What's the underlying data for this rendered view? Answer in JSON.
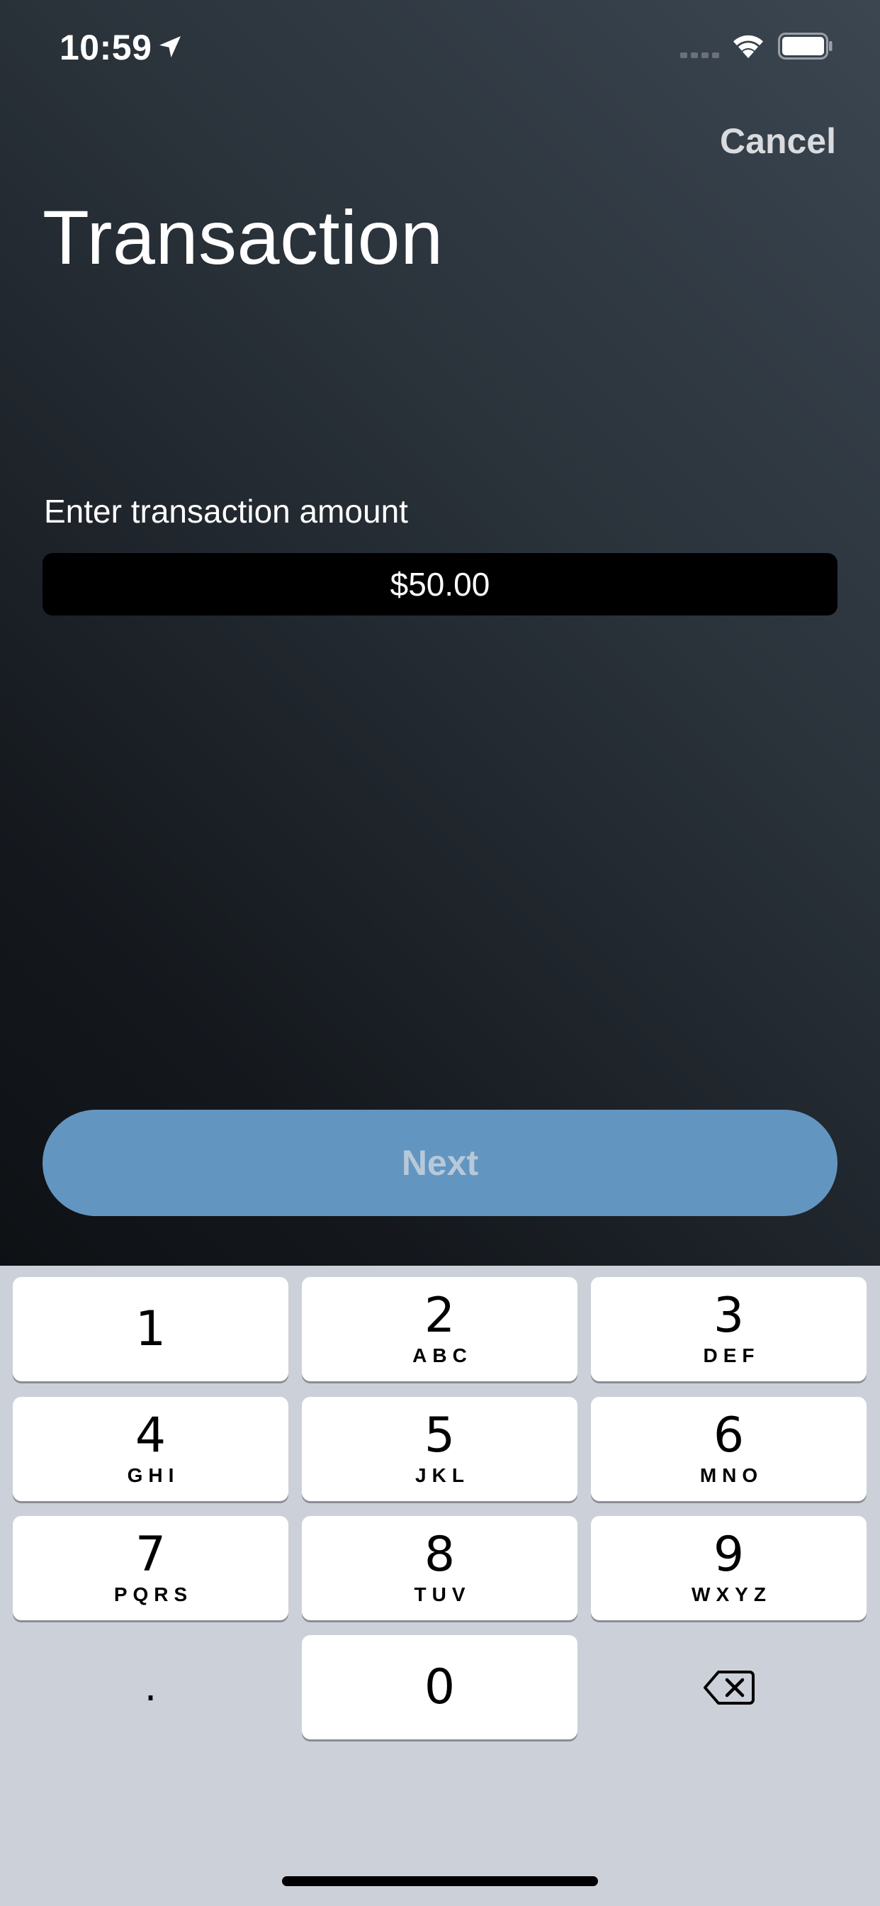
{
  "status_bar": {
    "time": "10:59",
    "icons": [
      "location-arrow-icon",
      "cellular-signal-icon",
      "wifi-icon",
      "battery-icon"
    ]
  },
  "header": {
    "cancel_label": "Cancel",
    "title": "Transaction"
  },
  "form": {
    "amount_label": "Enter transaction amount",
    "amount_value": "$50.00"
  },
  "next_label": "Next",
  "keypad": {
    "keys": [
      {
        "digit": "1",
        "letters": ""
      },
      {
        "digit": "2",
        "letters": "ABC"
      },
      {
        "digit": "3",
        "letters": "DEF"
      },
      {
        "digit": "4",
        "letters": "GHI"
      },
      {
        "digit": "5",
        "letters": "JKL"
      },
      {
        "digit": "6",
        "letters": "MNO"
      },
      {
        "digit": "7",
        "letters": "PQRS"
      },
      {
        "digit": "8",
        "letters": "TUV"
      },
      {
        "digit": "9",
        "letters": "WXYZ"
      },
      {
        "digit": "0",
        "letters": ""
      }
    ],
    "decimal_label": ".",
    "delete_icon": "backspace-icon"
  },
  "colors": {
    "next_button": "#6395c1",
    "keypad_bg": "#ccd0d8"
  }
}
